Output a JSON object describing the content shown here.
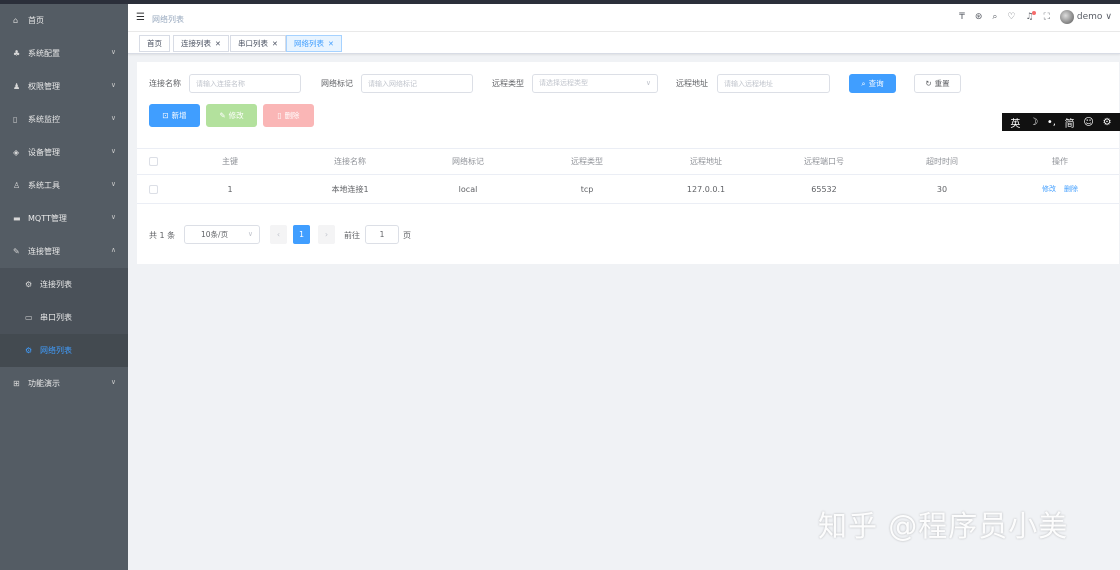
{
  "sidebar": {
    "items": [
      {
        "label": "首页",
        "icon": "home-icon"
      },
      {
        "label": "系统配置",
        "icon": "tree-icon"
      },
      {
        "label": "权限管理",
        "icon": "user-icon"
      },
      {
        "label": "系统监控",
        "icon": "monitor-icon"
      },
      {
        "label": "设备管理",
        "icon": "device-icon"
      },
      {
        "label": "系统工具",
        "icon": "tool-icon"
      },
      {
        "label": "MQTT管理",
        "icon": "mqtt-icon"
      },
      {
        "label": "连接管理",
        "icon": "link-icon"
      },
      {
        "label": "连接列表",
        "icon": "gear-icon"
      },
      {
        "label": "串口列表",
        "icon": "laptop-icon"
      },
      {
        "label": "网络列表",
        "icon": "network-icon"
      },
      {
        "label": "功能演示",
        "icon": "grid-icon"
      }
    ]
  },
  "header": {
    "breadcrumb": "网络列表",
    "user": "demo"
  },
  "tabs": [
    {
      "label": "首页"
    },
    {
      "label": "连接列表"
    },
    {
      "label": "串口列表"
    },
    {
      "label": "网络列表"
    }
  ],
  "form": {
    "name_label": "连接名称",
    "name_placeholder": "请输入连接名称",
    "flag_label": "网络标记",
    "flag_placeholder": "请输入网络标记",
    "type_label": "远程类型",
    "type_placeholder": "请选择远程类型",
    "addr_label": "远程地址",
    "addr_placeholder": "请输入远程地址",
    "search": "查询",
    "reset": "重置"
  },
  "toolbar": {
    "add": "新增",
    "edit": "修改",
    "delete": "删除"
  },
  "ime": {
    "lang": "英",
    "moon": "☽",
    "punct": "•,",
    "mode": "简",
    "smile": "☺",
    "gear": "⚙"
  },
  "table": {
    "headers": [
      "主键",
      "连接名称",
      "网络标记",
      "远程类型",
      "远程地址",
      "远程端口号",
      "超时时间",
      "操作"
    ],
    "rows": [
      {
        "id": "1",
        "name": "本地连接1",
        "flag": "local",
        "type": "tcp",
        "addr": "127.0.0.1",
        "port": "65532",
        "timeout": "30",
        "edit": "修改",
        "delete": "删除"
      }
    ]
  },
  "pagination": {
    "total": "共 1 条",
    "size": "10条/页",
    "page": "1",
    "goto": "前往",
    "goto_value": "1",
    "page_unit": "页"
  },
  "watermark": "知乎 @程序员小美",
  "colors": {
    "sidebar": "#545c64",
    "primary": "#409eff",
    "active_menu": "#409eff"
  }
}
